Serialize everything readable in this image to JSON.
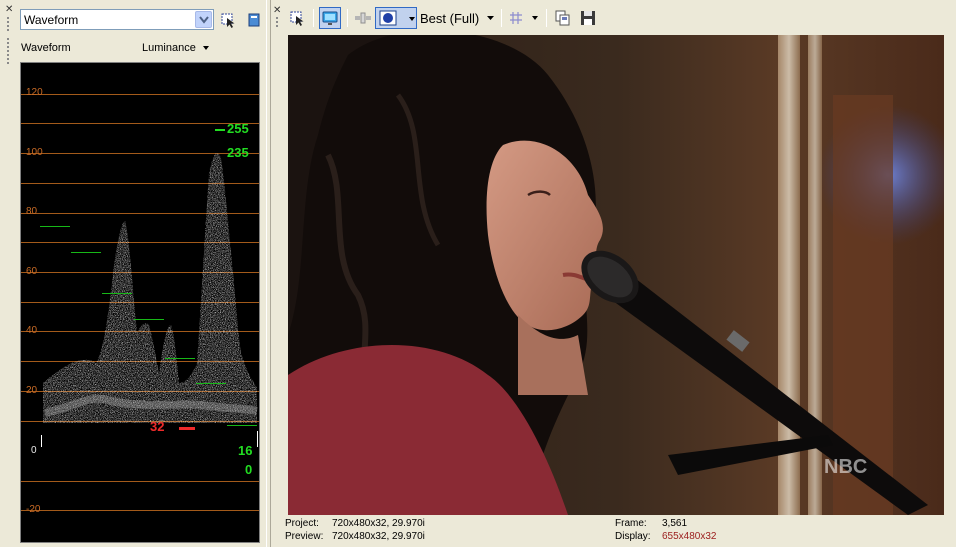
{
  "scopes": {
    "scope_type_value": "Waveform",
    "scope_title": "Waveform",
    "scope_mode": "Luminance",
    "y_axis_labels": [
      "120",
      "100",
      "80",
      "60",
      "40",
      "20",
      "0",
      "-20"
    ],
    "markers": {
      "white_level": "255",
      "white_broadcast": "235",
      "black_broadcast": "16",
      "black_level": "0",
      "cursor_value": "32"
    },
    "colors": {
      "grid": "#a35a1a",
      "marker_green": "#22dd22",
      "marker_red": "#ee2a2a",
      "scope_bg": "#000000"
    }
  },
  "preview": {
    "quality_label": "Best (Full)",
    "status": {
      "project_label": "Project:",
      "project_value": "720x480x32, 29.970i",
      "preview_label": "Preview:",
      "preview_value": "720x480x32, 29.970i",
      "frame_label": "Frame:",
      "frame_value": "3,561",
      "display_label": "Display:",
      "display_value": "655x480x32"
    },
    "video": {
      "content": "woman-singing-into-microphone",
      "watermark": "NBC"
    }
  },
  "icons": {
    "close": "close-icon",
    "selection": "selection-tool-icon",
    "split_screen": "split-screen-icon",
    "preview_monitor": "external-monitor-icon",
    "overlays": "overlays-icon",
    "grid": "grid-icon",
    "copy_snapshot": "copy-snapshot-icon",
    "save_snapshot": "save-snapshot-icon"
  }
}
